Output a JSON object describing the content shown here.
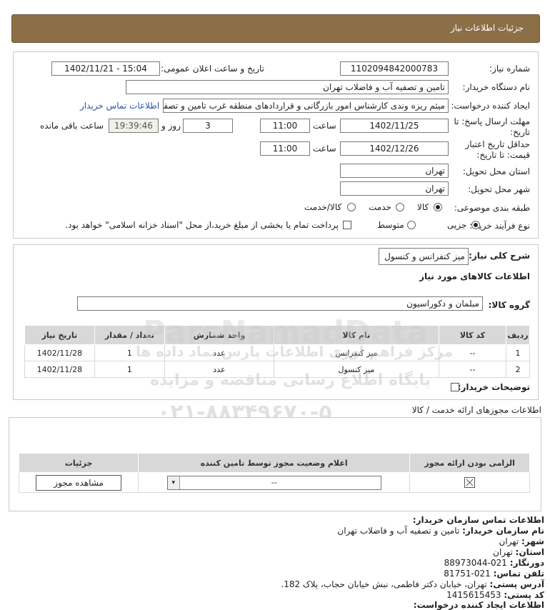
{
  "header": {
    "title": "جزئیات اطلاعات نیاز"
  },
  "form": {
    "need_number_label": "شماره نیاز:",
    "need_number": "1102094842000783",
    "announce_label": "تاریخ و ساعت اعلان عمومی:",
    "announce_value": "1402/11/21 - 15:04",
    "buyer_org_label": "نام دستگاه خریدار:",
    "buyer_org": "تامین و تصفیه آب و فاضلاب تهران",
    "creator_label": "ایجاد کننده درخواست:",
    "creator": "میثم ریزه وندی کارشناس امور بازرگانی و قراردادهای منطقه غرب تامین و تصفیه",
    "contact_link": "اطلاعات تماس خریدار",
    "deadline_label_1": "مهلت ارسال پاسخ: تا",
    "deadline_label_2": "تاریخ:",
    "deadline_date": "1402/11/25",
    "time_label": "ساعت",
    "deadline_time": "11:00",
    "days_value": "3",
    "days_label": "روز و",
    "remaining_time": "19:39:46",
    "remaining_label": "ساعت باقی مانده",
    "validity_label_1": "حداقل تاریخ اعتبار",
    "validity_label_2": "قیمت: تا تاریخ:",
    "validity_date": "1402/12/26",
    "validity_time": "11:00",
    "province_label": "استان محل تحویل:",
    "province": "تهران",
    "city_label": "شهر محل تحویل:",
    "city": "تهران",
    "category_label": "طبقه بندی موضوعی:",
    "cat_goods": "کالا",
    "cat_service": "خدمت",
    "cat_both": "کالا/خدمت",
    "process_label": "نوع فرآیند خرید :",
    "proc_minor": "جزیی",
    "proc_medium": "متوسط",
    "payment_note": "پرداخت تمام یا بخشی از مبلغ خرید،از محل \"اسناد خزانه اسلامی\" خواهد بود."
  },
  "desc": {
    "summary_label": "شرح کلی نیاز:",
    "summary": "میز کنفرانس و کنسول",
    "goods_info_title": "اطلاعات کالاهای مورد نیاز",
    "group_label": "گروه کالا:",
    "group_value": "مبلمان و دکوراسیون",
    "columns": [
      "ردیف",
      "کد کالا",
      "نام کالا",
      "واحد شمارش",
      "تعداد / مقدار",
      "تاریخ نیاز"
    ],
    "rows": [
      [
        "1",
        "--",
        "میز کنفرانس",
        "عدد",
        "1",
        "1402/11/28"
      ],
      [
        "2",
        "--",
        "میز کنسول",
        "عدد",
        "1",
        "1402/11/28"
      ]
    ],
    "buyer_notes_label": "توضیحات خریدار:"
  },
  "permits": {
    "title": "اطلاعات مجوزهای ارائه خدمت / کالا",
    "columns": [
      "الزامی بودن ارائه مجوز",
      "اعلام وضعیت مجوز توسط تامین کننده",
      "جزئیات"
    ],
    "status_value": "--",
    "view_button": "مشاهده مجوز"
  },
  "contact": {
    "title": "اطلاعات تماس سازمان خریدار:",
    "org_label": "نام سازمان خریدار:",
    "org": "تامین و تصفیه آب و فاضلاب تهران",
    "city_label": "شهر:",
    "city": "تهران",
    "province_label": "استان:",
    "province": "تهران",
    "fax_label": "دورنگار:",
    "fax": "021-88973044",
    "phone_label": "تلفن تماس:",
    "phone": "021-81751",
    "address_label": "آدرس پستی:",
    "address": "تهران، خیابان دکتر فاطمی، نبش خیابان حجاب، پلاک 182.",
    "postal_label": "کد پستی:",
    "postal": "1415615453",
    "creator_info_label": "اطلاعات ایجاد کننده درخواست:"
  },
  "watermark": {
    "brand": "ParsNamadData",
    "line1": "مرکز فراهم آوری اطلاعات پارس نماد داده ها",
    "line2": "پایگاه اطلاع رسانی مناقصه و مزایده",
    "phone": "۰۲۱-۸۸۳۴۹۶۷۰-۵"
  }
}
